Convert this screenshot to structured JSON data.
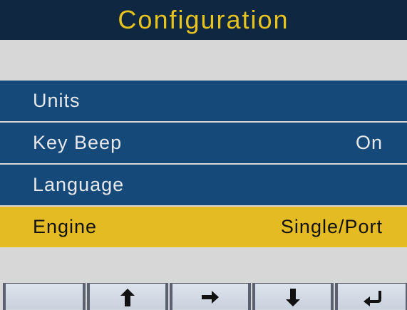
{
  "title": "Configuration",
  "menu": {
    "items": [
      {
        "label": "Units",
        "value": ""
      },
      {
        "label": "Key Beep",
        "value": "On"
      },
      {
        "label": "Language",
        "value": ""
      },
      {
        "label": "Engine",
        "value": "Single/Port",
        "selected": true
      }
    ]
  },
  "softkeys": [
    {
      "icon": "blank"
    },
    {
      "icon": "arrow-up-icon"
    },
    {
      "icon": "arrow-right-icon"
    },
    {
      "icon": "arrow-down-icon"
    },
    {
      "icon": "enter-return-icon"
    }
  ],
  "colors": {
    "title_bg": "#0f2740",
    "title_text": "#e7c31d",
    "row_bg": "#14497a",
    "row_text": "#e8e8e8",
    "selected_bg": "#e4bb22",
    "selected_text": "#111111",
    "background": "#d7d7d7"
  }
}
